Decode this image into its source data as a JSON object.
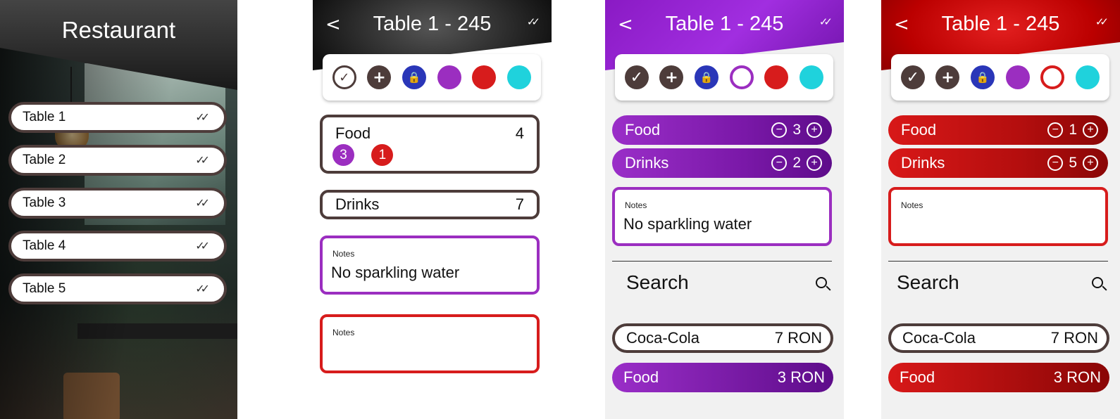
{
  "restaurant": {
    "title": "Restaurant",
    "tables": [
      "Table 1",
      "Table 2",
      "Table 3",
      "Table 4",
      "Table 5"
    ]
  },
  "header": {
    "title": "Table 1 - 245",
    "back": "<",
    "done_icon": "double-check-icon"
  },
  "toolbar_icons": [
    "check-icon",
    "plus-icon",
    "lock-icon",
    "purple-color",
    "red-color",
    "cyan-color"
  ],
  "colors": {
    "dark": "#4d3c3a",
    "purple": "#9b2ec0",
    "red": "#d71c1c",
    "cyan": "#1fd2dc",
    "blue": "#2a36b8"
  },
  "screen2": {
    "food_label": "Food",
    "food_count": "4",
    "food_badges": [
      "3",
      "1"
    ],
    "drinks_label": "Drinks",
    "drinks_count": "7",
    "notes_label": "Notes",
    "notes_value": "No sparkling water",
    "notes2_label": "Notes",
    "notes2_value": ""
  },
  "screen3": {
    "food_label": "Food",
    "food_qty": "3",
    "drinks_label": "Drinks",
    "drinks_qty": "2",
    "notes_label": "Notes",
    "notes_value": "No sparkling water",
    "search_label": "Search",
    "results": [
      {
        "name": "Coca-Cola",
        "price": "7 RON"
      },
      {
        "name": "Food",
        "price": "3 RON"
      }
    ]
  },
  "screen4": {
    "food_label": "Food",
    "food_qty": "1",
    "drinks_label": "Drinks",
    "drinks_qty": "5",
    "notes_label": "Notes",
    "notes_value": "",
    "search_label": "Search",
    "results": [
      {
        "name": "Coca-Cola",
        "price": "7 RON"
      },
      {
        "name": "Food",
        "price": "3 RON"
      }
    ]
  }
}
